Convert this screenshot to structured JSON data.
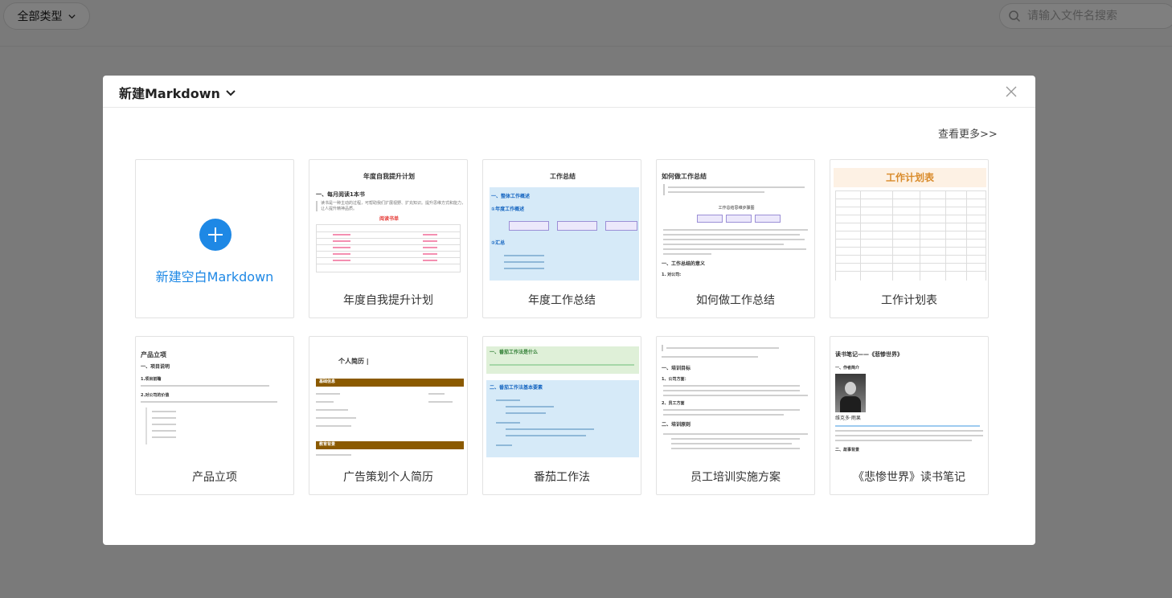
{
  "toolbar": {
    "type_filter_label": "全部类型",
    "search_placeholder": "请输入文件名搜索"
  },
  "modal": {
    "title": "新建Markdown",
    "see_more": "查看更多>>",
    "blank_card_label": "新建空白Markdown"
  },
  "templates": [
    {
      "label": "年度自我提升计划",
      "thumb": {
        "title": "年度自我提升计划",
        "heading": "一、每月阅读1本书",
        "quote": "读书是一种主动的过程，可帮助我们扩展视野、扩充知识。提升思维方式和能力，让人提升精神品质。",
        "table_title": "阅读书单"
      }
    },
    {
      "label": "年度工作总结",
      "thumb": {
        "title": "工作总结",
        "heading": "一、整体工作概述",
        "sub1": "①年度工作概述",
        "sub2": "②汇总"
      }
    },
    {
      "label": "如何做工作总结",
      "thumb": {
        "title": "如何做工作总结",
        "diagram_title": "工作总结思维步骤图",
        "heading": "一、工作总结的意义",
        "sub": "1. 对公司:"
      }
    },
    {
      "label": "工作计划表",
      "thumb": {
        "title": "工作计划表"
      }
    },
    {
      "label": "产品立项",
      "thumb": {
        "title": "产品立项",
        "heading": "一、项目说明",
        "sub1": "1.项目前瞻",
        "sub2": "2.对公司的价值"
      }
    },
    {
      "label": "广告策划个人简历",
      "thumb": {
        "title": "个人简历 |",
        "section1": "基础信息",
        "section2": "教育背景"
      }
    },
    {
      "label": "番茄工作法",
      "thumb": {
        "heading1": "一、番茄工作法是什么",
        "heading2": "二、番茄工作法基本要素"
      }
    },
    {
      "label": "员工培训实施方案",
      "thumb": {
        "heading1": "一、培训目标",
        "sub1": "1、公司方面：",
        "sub2": "2、员工方面",
        "heading2": "二、培训原则"
      }
    },
    {
      "label": "《悲惨世界》读书笔记",
      "thumb": {
        "title": "读书笔记——《悲惨世界》",
        "heading1": "一、作者简介",
        "author": "维克多·雨果",
        "heading2": "二、故事背景"
      }
    }
  ],
  "colors": {
    "accent": "#1e88e5",
    "overlay": "rgba(0,0,0,0.5)"
  }
}
